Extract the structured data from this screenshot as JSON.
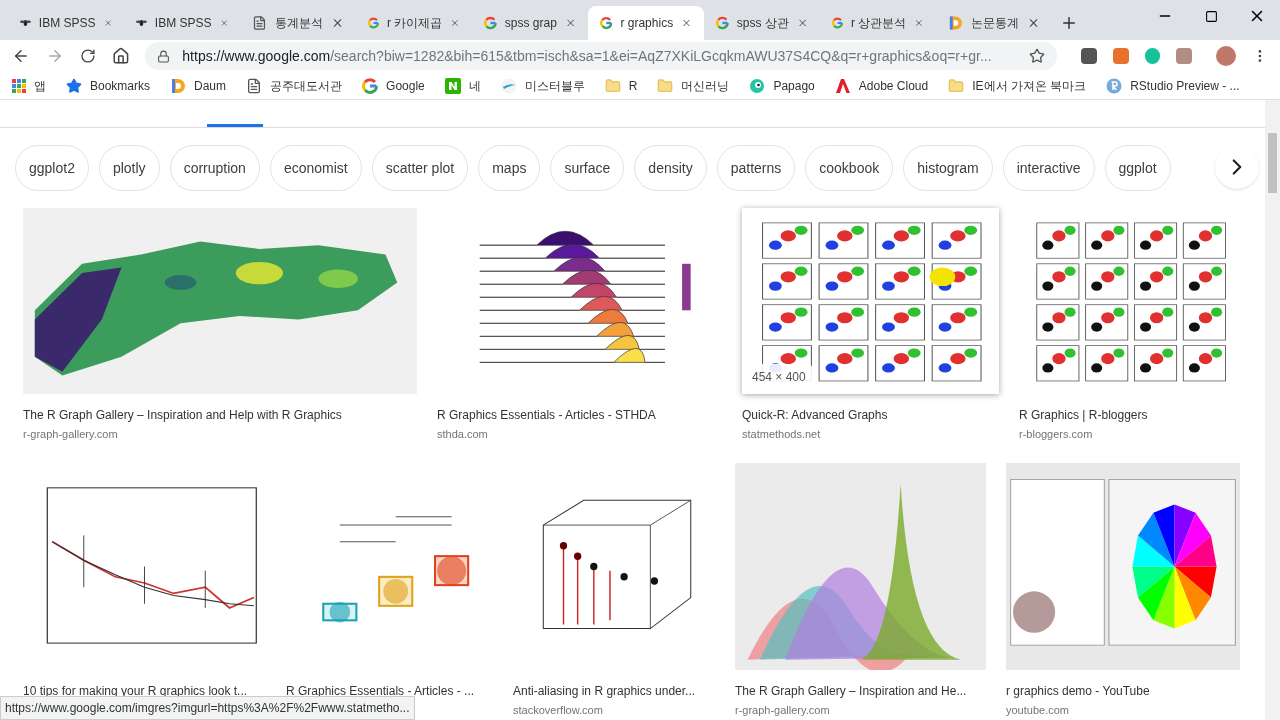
{
  "tabs": [
    {
      "title": "IBM SPSS",
      "kind": "bee",
      "selected": false
    },
    {
      "title": "IBM SPSS",
      "kind": "bee",
      "selected": false
    },
    {
      "title": "통계분석",
      "kind": "doc",
      "selected": false
    },
    {
      "title": "r 카이제곱",
      "kind": "google",
      "selected": false
    },
    {
      "title": "spss grap",
      "kind": "google",
      "selected": false
    },
    {
      "title": "r graphics",
      "kind": "google",
      "selected": true
    },
    {
      "title": "spss 상관",
      "kind": "google",
      "selected": false
    },
    {
      "title": "r 상관분석",
      "kind": "google",
      "selected": false
    },
    {
      "title": "논문통계",
      "kind": "daum",
      "selected": false
    }
  ],
  "address": {
    "host": "https://www.google.com",
    "path": "/search?biw=1282&bih=615&tbm=isch&sa=1&ei=AqZ7XKiLGcqkmAWU37S4CQ&q=r+graphics&oq=r+gr..."
  },
  "bookmarks": [
    {
      "label": "앱",
      "kind": "apps"
    },
    {
      "label": "Bookmarks",
      "kind": "star"
    },
    {
      "label": "Daum",
      "kind": "daum"
    },
    {
      "label": "공주대도서관",
      "kind": "doc"
    },
    {
      "label": "Google",
      "kind": "google"
    },
    {
      "label": "네",
      "kind": "naver"
    },
    {
      "label": "미스터블루",
      "kind": "wave"
    },
    {
      "label": "R",
      "kind": "folder"
    },
    {
      "label": "머신러닝",
      "kind": "folder"
    },
    {
      "label": "Papago",
      "kind": "papago"
    },
    {
      "label": "Adobe Cloud",
      "kind": "adobe"
    },
    {
      "label": "IE에서 가져온 북마크",
      "kind": "folder"
    },
    {
      "label": "RStudio Preview - ...",
      "kind": "rstudio"
    }
  ],
  "chips": [
    "ggplot2",
    "plotly",
    "corruption",
    "economist",
    "scatter plot",
    "maps",
    "surface",
    "density",
    "patterns",
    "cookbook",
    "histogram",
    "interactive",
    "ggplot"
  ],
  "image_rows": [
    [
      {
        "kind": "map",
        "caption": "The R Graph Gallery – Inspiration and Help with R Graphics",
        "source": "r-graph-gallery.com"
      },
      {
        "kind": "ridges",
        "caption": "R Graphics Essentials - Articles - STHDA",
        "source": "sthda.com"
      },
      {
        "kind": "pairs",
        "caption": "Quick-R: Advanced Graphs",
        "source": "statmethods.net",
        "size_label": "454 × 400"
      },
      {
        "kind": "pairs2",
        "caption": "R Graphics | R-bloggers",
        "source": "r-bloggers.com"
      }
    ],
    [
      {
        "kind": "line",
        "caption": "10 tips for making your R graphics look t..."
      },
      {
        "kind": "box",
        "caption": "R Graphics Essentials - Articles - ..."
      },
      {
        "kind": "scatter3d",
        "caption": "Anti-aliasing in R graphics under...",
        "source": "stackoverflow.com"
      },
      {
        "kind": "density",
        "caption": "The R Graph Gallery – Inspiration and He...",
        "source": "r-graph-gallery.com"
      },
      {
        "kind": "wheel",
        "caption": "r graphics demo - YouTube",
        "source": "youtube.com"
      }
    ]
  ],
  "status_url": "https://www.google.com/imgres?imgurl=https%3A%2F%2Fwww.statmetho..."
}
